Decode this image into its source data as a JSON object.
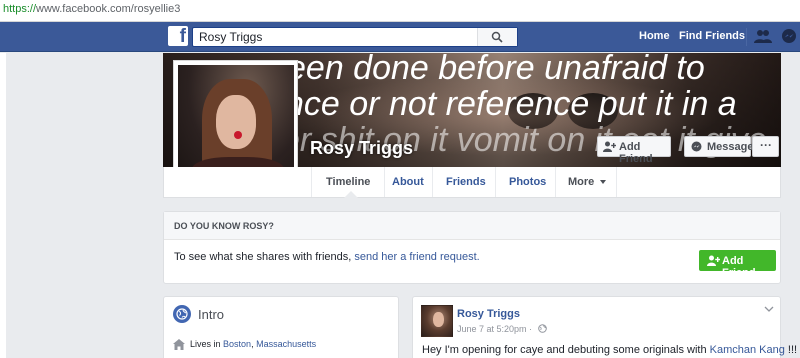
{
  "browser": {
    "url_scheme": "https://",
    "url_rest": "www.facebook.com/rosyellie3"
  },
  "topbar": {
    "logo": "f",
    "search_value": "Rosy Triggs",
    "home_label": "Home",
    "find_friends_label": "Find Friends",
    "brand_color": "#3b5998"
  },
  "cover": {
    "overlay_lines": [
      "een done before unafraid to",
      "nce or not reference put it in a",
      "er shit on it vomit on it eat it give"
    ]
  },
  "profile": {
    "name": "Rosy Triggs",
    "add_friend_label": "Add Friend",
    "message_label": "Message",
    "more_label": "···"
  },
  "tabs": {
    "timeline": "Timeline",
    "about": "About",
    "friends": "Friends",
    "photos": "Photos",
    "more": "More"
  },
  "know": {
    "header": "DO YOU KNOW ROSY?",
    "text": "To see what she shares with friends, ",
    "link": "send her a friend request.",
    "button": "Add Friend",
    "button_color": "#42b72a"
  },
  "intro": {
    "title": "Intro",
    "lives_prefix": "Lives in ",
    "city": "Boston",
    "sep": ", ",
    "state": "Massachusetts"
  },
  "post": {
    "author": "Rosy Triggs",
    "time": "June 7 at 5:20pm · ",
    "text": "Hey I'm opening for caye and debuting some originals with ",
    "mention": "Kamchan Kang",
    "suffix": " !!!"
  }
}
